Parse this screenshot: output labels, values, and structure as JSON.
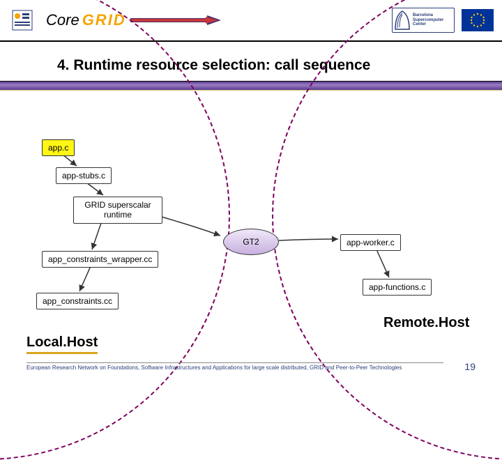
{
  "header": {
    "coregrid_part1": "Core",
    "coregrid_part2": "GRID",
    "bsc_line1": "Barcelona",
    "bsc_line2": "Supercomputer",
    "bsc_line3": "Center"
  },
  "title": "4.   Runtime resource selection: call sequence",
  "boxes": {
    "app": "app.c",
    "stubs": "app-stubs.c",
    "runtime": "GRID superscalar runtime",
    "gt2": "GT2",
    "wrapper": "app_constraints_wrapper.cc",
    "constraints": "app_constraints.cc",
    "worker": "app-worker.c",
    "functions": "app-functions.c"
  },
  "hosts": {
    "local": "Local.Host",
    "remote": "Remote.Host"
  },
  "footer": {
    "text": "European Research Network on Foundations, Software Infrastructures and Applications for large scale distributed, GRID and Peer-to-Peer Technologies",
    "page": "19"
  }
}
